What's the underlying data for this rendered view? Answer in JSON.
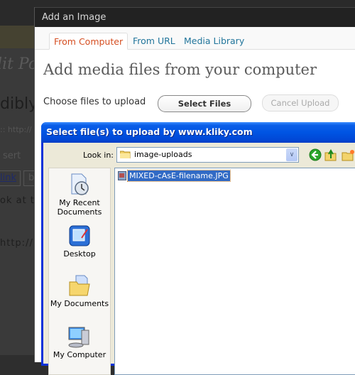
{
  "background": {
    "post_title_fragment": "lit Po",
    "heading_fragment": "dibly",
    "permalink_fragment": ":: http://",
    "insert_fragment": "sert",
    "link_button": "link",
    "b_button": "b",
    "text_fragment_1": "ok at th",
    "text_fragment_2": "http://"
  },
  "media_dialog": {
    "title": "Add an Image",
    "tabs": [
      {
        "label": "From Computer",
        "active": true
      },
      {
        "label": "From URL",
        "active": false
      },
      {
        "label": "Media Library",
        "active": false
      }
    ],
    "heading": "Add media files from your computer",
    "choose_label": "Choose files to upload",
    "select_files_button": "Select Files",
    "cancel_upload_button": "Cancel Upload"
  },
  "file_dialog": {
    "title": "Select file(s) to upload by www.kliky.com",
    "look_in_label": "Look in:",
    "look_in_value": "image-uploads",
    "places": [
      {
        "label": "My Recent Documents",
        "icon": "recent-documents-icon"
      },
      {
        "label": "Desktop",
        "icon": "desktop-icon"
      },
      {
        "label": "My Documents",
        "icon": "my-documents-icon"
      },
      {
        "label": "My Computer",
        "icon": "my-computer-icon"
      }
    ],
    "files": [
      {
        "name": "MIXED-cAsE-filename.JPG",
        "selected": true
      }
    ],
    "colors": {
      "title_bar": "#0054e3",
      "selection": "#316ac5"
    }
  }
}
